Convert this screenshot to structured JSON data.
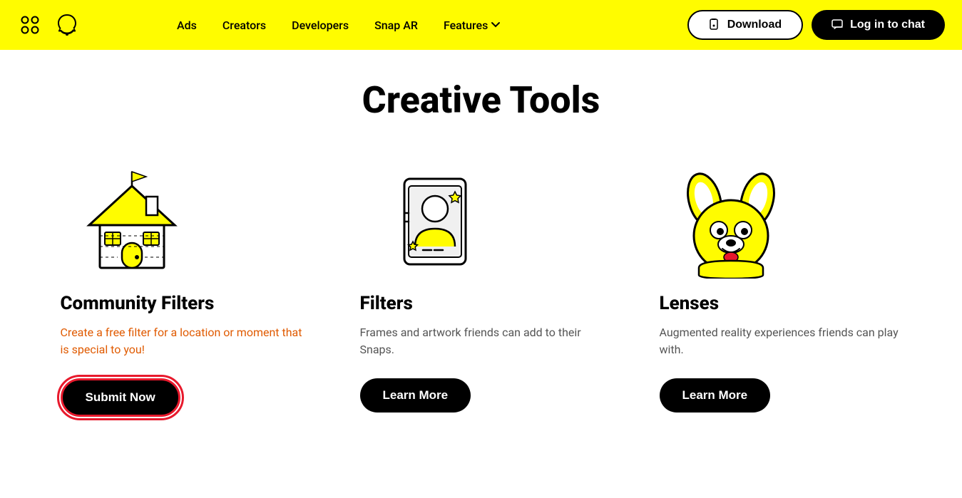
{
  "navbar": {
    "links": [
      {
        "id": "ads",
        "label": "Ads"
      },
      {
        "id": "creators",
        "label": "Creators"
      },
      {
        "id": "developers",
        "label": "Developers"
      },
      {
        "id": "snap-ar",
        "label": "Snap AR"
      },
      {
        "id": "features",
        "label": "Features"
      }
    ],
    "download_label": "Download",
    "login_label": "Log in to chat"
  },
  "main": {
    "title": "Creative Tools",
    "cards": [
      {
        "id": "community-filters",
        "title": "Community Filters",
        "desc_highlight": "Create a free filter for a location or moment that is special to you!",
        "cta": "Submit Now"
      },
      {
        "id": "filters",
        "title": "Filters",
        "desc": "Frames and artwork friends can add to their Snaps.",
        "cta": "Learn More"
      },
      {
        "id": "lenses",
        "title": "Lenses",
        "desc": "Augmented reality experiences friends can play with.",
        "cta": "Learn More"
      }
    ]
  }
}
